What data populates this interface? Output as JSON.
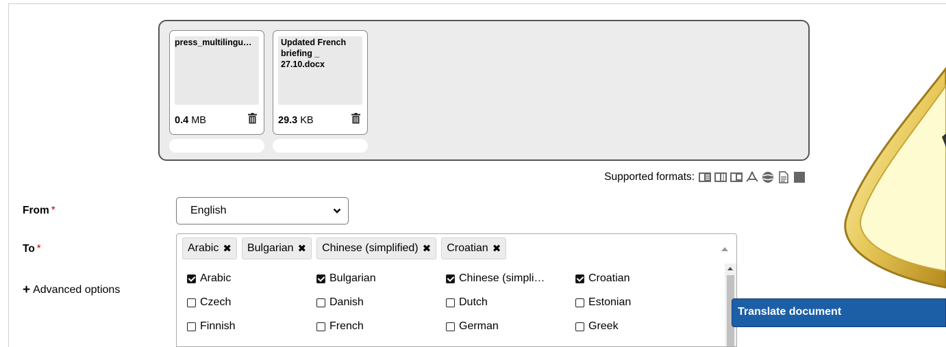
{
  "files": [
    {
      "name": "press_multilingu…",
      "size_value": "0.4",
      "size_unit": "MB"
    },
    {
      "name": "Updated French\nbriefing _\n27.10.docx",
      "size_value": "29.3",
      "size_unit": "KB"
    }
  ],
  "formats_label": "Supported formats:",
  "format_icons": [
    "word-icon",
    "excel-icon",
    "powerpoint-icon",
    "pdf-icon",
    "web-icon",
    "text-file-icon",
    "image-icon"
  ],
  "from": {
    "label": "From",
    "required_mark": "*",
    "value": "English"
  },
  "to": {
    "label": "To",
    "required_mark": "*",
    "tags": [
      "Arabic",
      "Bulgarian",
      "Chinese (simplified)",
      "Croatian"
    ],
    "tag_remove_glyph": "✖"
  },
  "options": [
    {
      "label": "Arabic",
      "checked": true
    },
    {
      "label": "Bulgarian",
      "checked": true
    },
    {
      "label": "Chinese (simpli…",
      "checked": true
    },
    {
      "label": "Croatian",
      "checked": true
    },
    {
      "label": "Czech",
      "checked": false
    },
    {
      "label": "Danish",
      "checked": false
    },
    {
      "label": "Dutch",
      "checked": false
    },
    {
      "label": "Estonian",
      "checked": false
    },
    {
      "label": "Finnish",
      "checked": false
    },
    {
      "label": "French",
      "checked": false
    },
    {
      "label": "German",
      "checked": false
    },
    {
      "label": "Greek",
      "checked": false
    }
  ],
  "advanced_options": {
    "icon": "+",
    "label": "Advanced options"
  },
  "translate_button": "Translate document",
  "colors": {
    "accent": "#1d5fa7",
    "required": "#cc0000",
    "panel": "#ececec"
  }
}
